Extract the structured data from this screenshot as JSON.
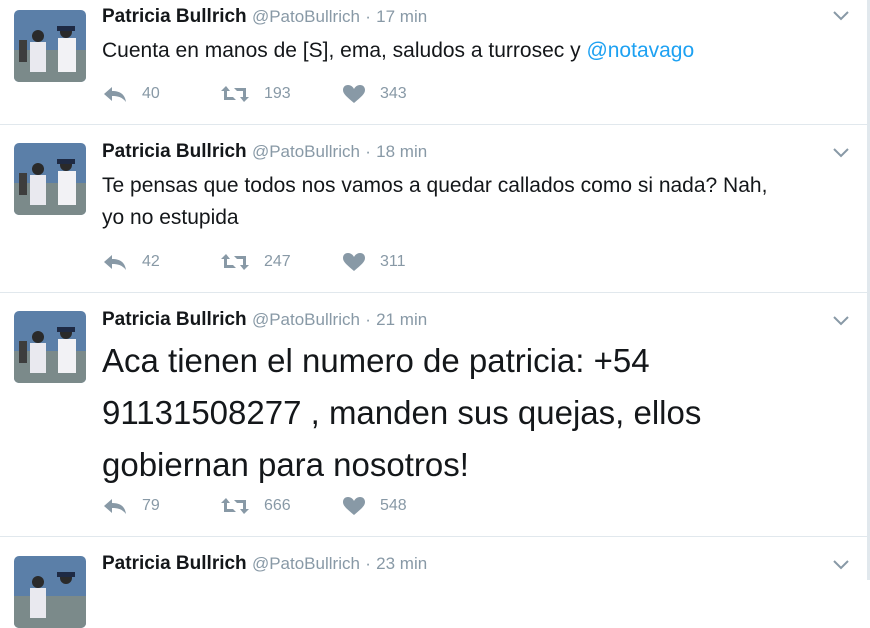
{
  "tweets": [
    {
      "name": "Patricia Bullrich",
      "handle": "@PatoBullrich",
      "dot": "·",
      "time": "17 min",
      "text": "Cuenta en manos de [S], ema, saludos a turrosec y ",
      "mention": "@notavago",
      "replies": "40",
      "retweets": "193",
      "likes": "343"
    },
    {
      "name": "Patricia Bullrich",
      "handle": "@PatoBullrich",
      "dot": "·",
      "time": "18 min",
      "text_line1": "Te pensas que todos nos vamos a quedar callados como si nada? Nah,",
      "text_line2": "yo no estupida",
      "replies": "42",
      "retweets": "247",
      "likes": "311"
    },
    {
      "name": "Patricia Bullrich",
      "handle": "@PatoBullrich",
      "dot": "·",
      "time": "21 min",
      "text_line1": "Aca tienen el numero de patricia: +54",
      "text_line2": "91131508277 , manden sus quejas, ellos",
      "text_line3": "gobiernan para nosotros!",
      "replies": "79",
      "retweets": "666",
      "likes": "548"
    },
    {
      "name": "Patricia Bullrich",
      "handle": "@PatoBullrich",
      "dot": "·",
      "time": "23 min"
    }
  ],
  "icons": {
    "reply": "reply-icon",
    "retweet": "retweet-icon",
    "like": "heart-icon",
    "menu": "chevron-down-icon"
  },
  "colors": {
    "link": "#1da1f2",
    "muted": "#8899a6",
    "text": "#14171a"
  }
}
